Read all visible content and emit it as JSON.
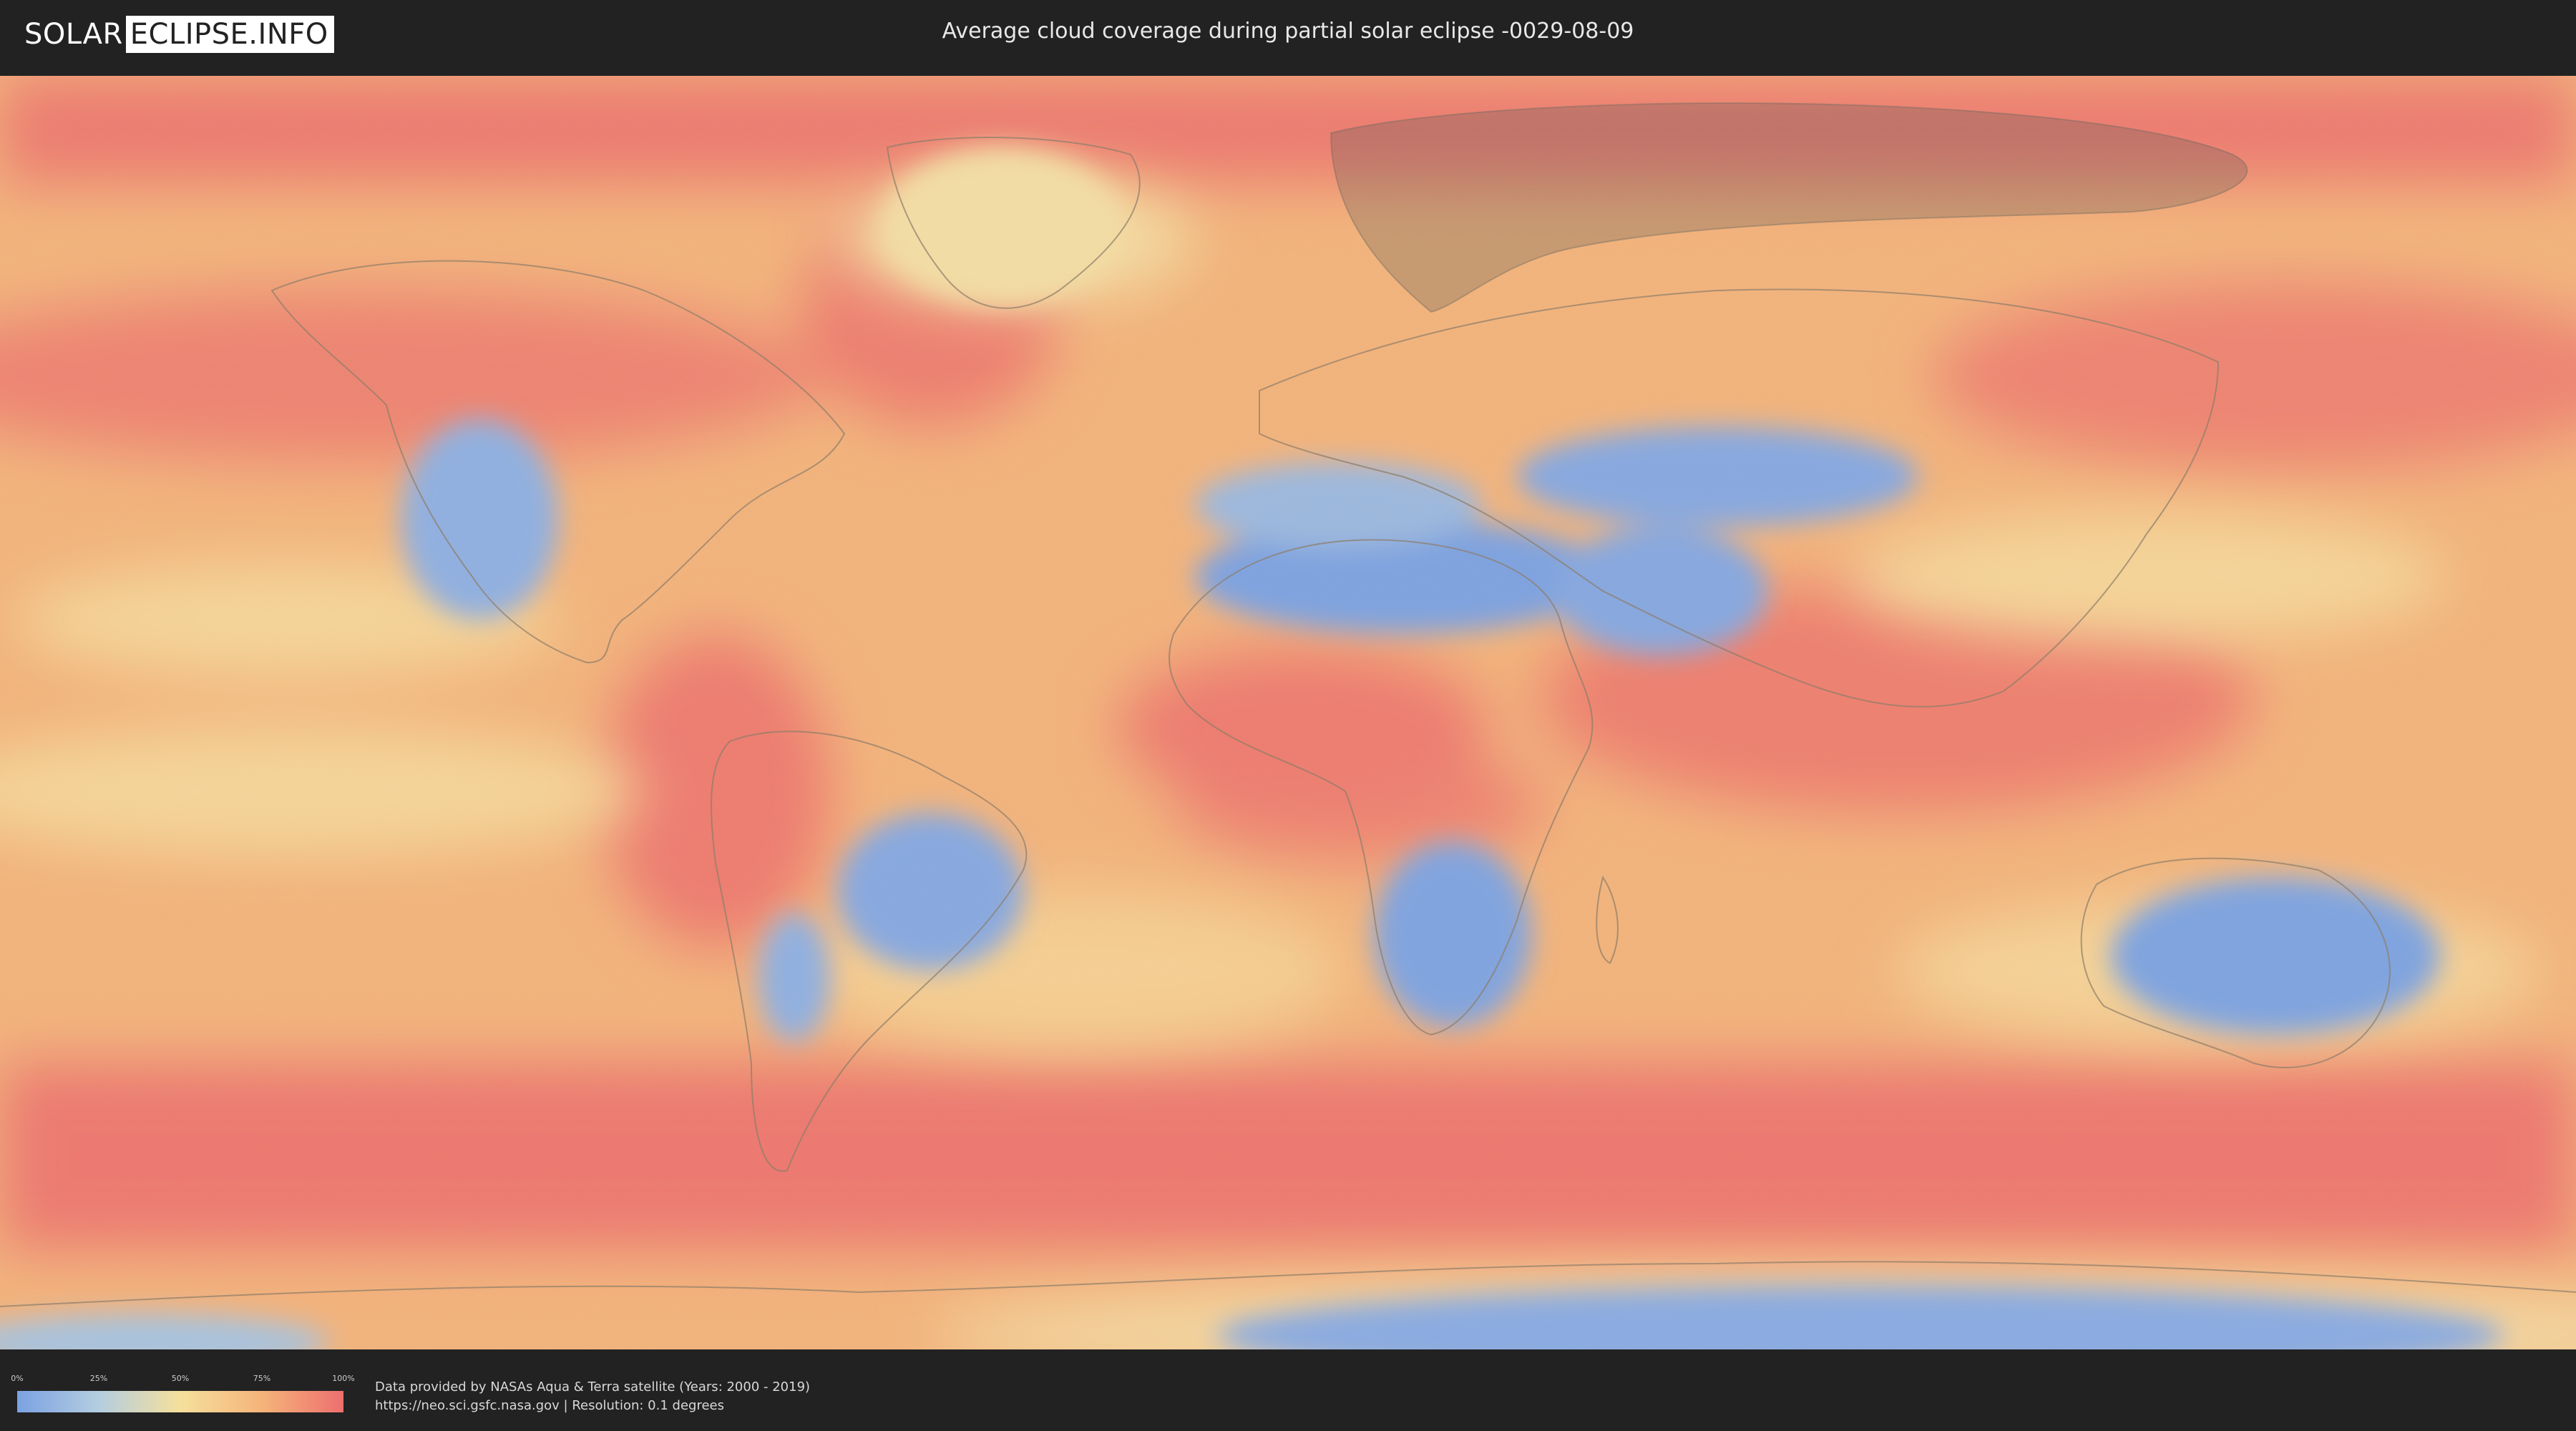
{
  "header": {
    "logo_left": "SOLAR",
    "logo_right": "ECLIPSE.INFO",
    "title": "Average cloud coverage during partial solar eclipse -0029-08-09"
  },
  "map": {
    "subject": "world cloud coverage",
    "colors": {
      "low": "#7ba2e2",
      "lowmid": "#b4cde0",
      "mid": "#f5e09c",
      "midhigh": "#f5b47a",
      "high": "#ed6f6f",
      "eclipse_overlay": "#5a5a55",
      "border": "#8a7a66"
    }
  },
  "legend": {
    "ticks": [
      "0%",
      "25%",
      "50%",
      "75%",
      "100%"
    ]
  },
  "credits": {
    "line1": "Data provided by NASAs Aqua & Terra satellite (Years: 2000 - 2019)",
    "line2": "https://neo.sci.gsfc.nasa.gov | Resolution: 0.1 degrees"
  }
}
